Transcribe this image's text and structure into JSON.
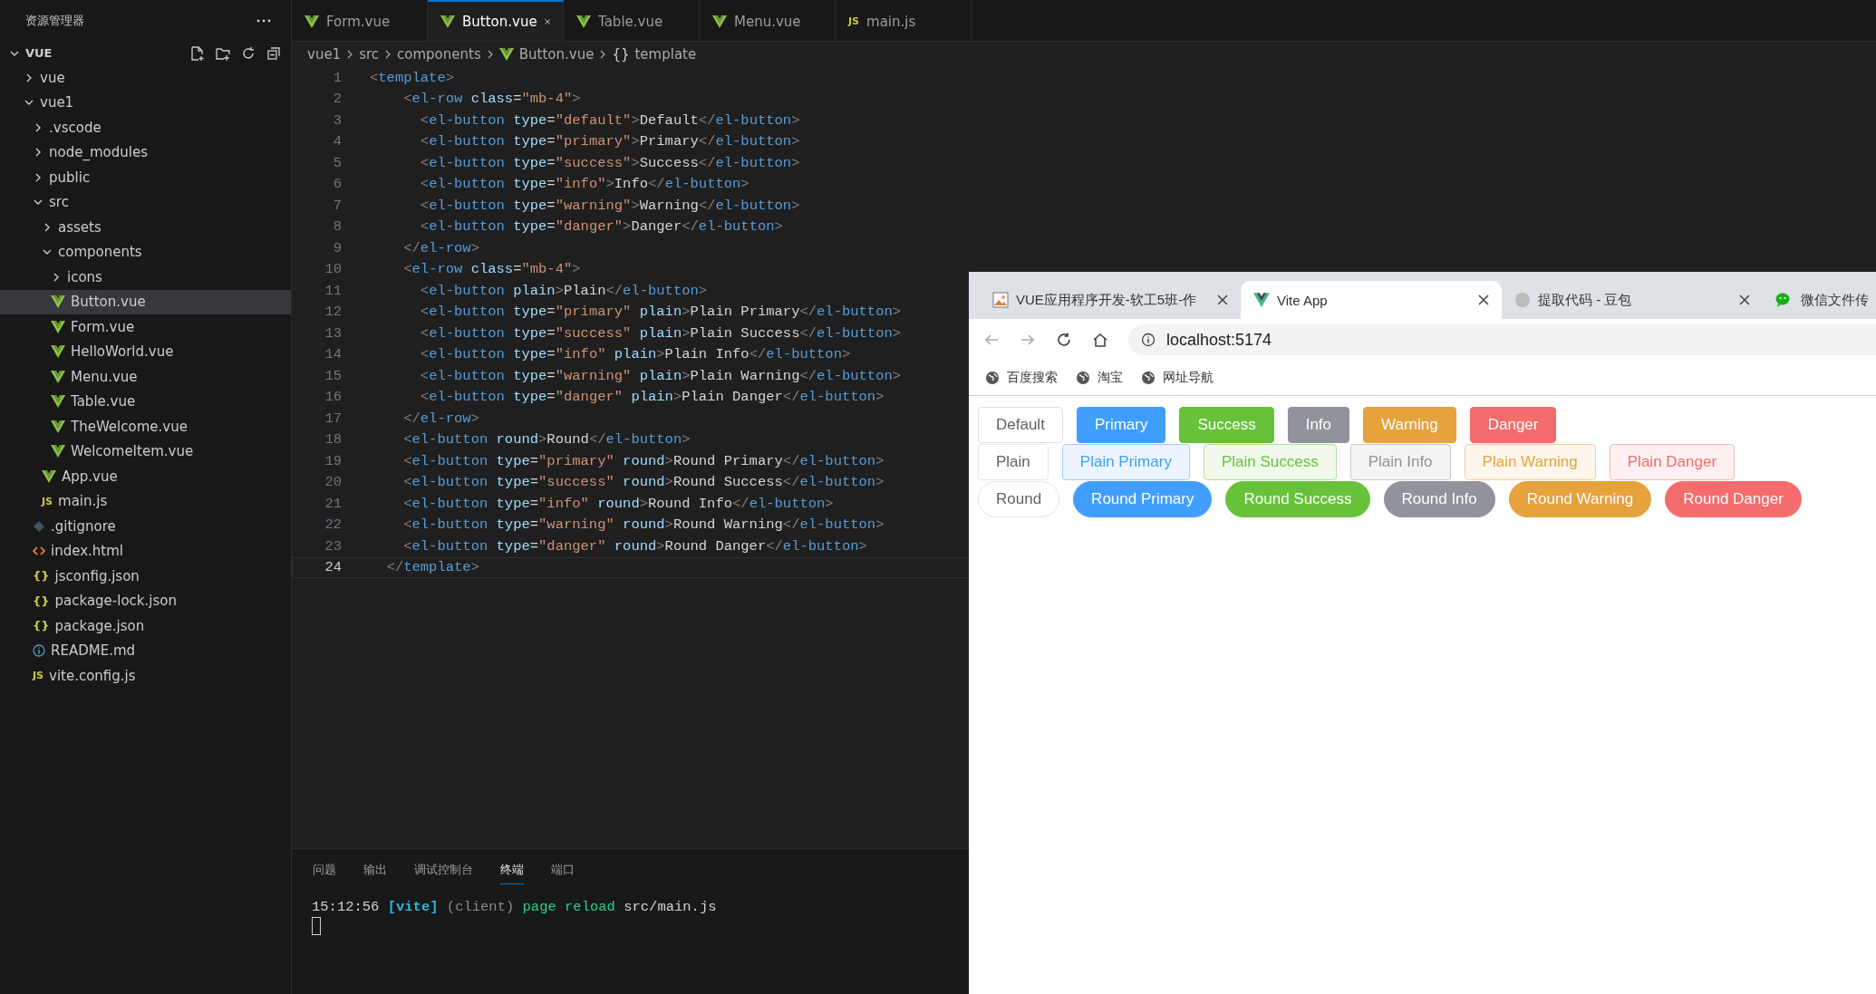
{
  "explorer": {
    "title": "资源管理器",
    "root": {
      "label": "VUE",
      "expanded": true,
      "children": [
        {
          "label": "vue",
          "kind": "folder",
          "expanded": false,
          "selected": false
        },
        {
          "label": "vue1",
          "kind": "folder",
          "expanded": true,
          "selected": false,
          "children": [
            {
              "label": ".vscode",
              "kind": "folder",
              "expanded": false,
              "selected": false
            },
            {
              "label": "node_modules",
              "kind": "folder",
              "expanded": false,
              "selected": false
            },
            {
              "label": "public",
              "kind": "folder",
              "expanded": false,
              "selected": false
            },
            {
              "label": "src",
              "kind": "folder",
              "expanded": true,
              "selected": false,
              "children": [
                {
                  "label": "assets",
                  "kind": "folder",
                  "expanded": false,
                  "selected": false
                },
                {
                  "label": "components",
                  "kind": "folder",
                  "expanded": true,
                  "selected": false,
                  "children": [
                    {
                      "label": "icons",
                      "kind": "folder",
                      "expanded": false,
                      "selected": false
                    },
                    {
                      "label": "Button.vue",
                      "kind": "vue",
                      "selected": true
                    },
                    {
                      "label": "Form.vue",
                      "kind": "vue",
                      "selected": false
                    },
                    {
                      "label": "HelloWorld.vue",
                      "kind": "vue",
                      "selected": false
                    },
                    {
                      "label": "Menu.vue",
                      "kind": "vue",
                      "selected": false
                    },
                    {
                      "label": "Table.vue",
                      "kind": "vue",
                      "selected": false
                    },
                    {
                      "label": "TheWelcome.vue",
                      "kind": "vue",
                      "selected": false
                    },
                    {
                      "label": "WelcomeItem.vue",
                      "kind": "vue",
                      "selected": false
                    }
                  ]
                },
                {
                  "label": "App.vue",
                  "kind": "vue",
                  "selected": false
                },
                {
                  "label": "main.js",
                  "kind": "js",
                  "icon_text": "JS",
                  "selected": false
                }
              ]
            },
            {
              "label": ".gitignore",
              "kind": "git",
              "selected": false
            },
            {
              "label": "index.html",
              "kind": "html",
              "selected": false
            },
            {
              "label": "jsconfig.json",
              "kind": "json",
              "icon_text": "{}",
              "selected": false
            },
            {
              "label": "package-lock.json",
              "kind": "json",
              "icon_text": "{}",
              "selected": false
            },
            {
              "label": "package.json",
              "kind": "json",
              "icon_text": "{}",
              "selected": false
            },
            {
              "label": "README.md",
              "kind": "info",
              "selected": false
            },
            {
              "label": "vite.config.js",
              "kind": "js",
              "icon_text": "JS",
              "selected": false
            }
          ]
        }
      ]
    }
  },
  "editor_tabs": [
    {
      "label": "Form.vue",
      "kind": "vue",
      "selected": false
    },
    {
      "label": "Button.vue",
      "kind": "vue",
      "selected": true
    },
    {
      "label": "Table.vue",
      "kind": "vue",
      "selected": false
    },
    {
      "label": "Menu.vue",
      "kind": "vue",
      "selected": false
    },
    {
      "label": "main.js",
      "kind": "js",
      "icon_text": "JS",
      "selected": false
    }
  ],
  "breadcrumbs": [
    {
      "label": "vue1",
      "kind": "folder"
    },
    {
      "label": "src",
      "kind": "folder"
    },
    {
      "label": "components",
      "kind": "folder"
    },
    {
      "label": "Button.vue",
      "kind": "vue"
    },
    {
      "label": "template",
      "kind": "symbol",
      "icon_text": "{}"
    }
  ],
  "code_lines": [
    {
      "number": "1",
      "current": false,
      "tokens": [
        {
          "kind": "punct",
          "text": "<"
        },
        {
          "kind": "tag",
          "text": "template"
        },
        {
          "kind": "punct",
          "text": ">"
        }
      ]
    },
    {
      "number": "2",
      "current": false,
      "tokens": [
        {
          "kind": "punct",
          "text": "    <"
        },
        {
          "kind": "tag",
          "text": "el-row"
        },
        {
          "kind": "attr",
          "text": " class"
        },
        {
          "kind": "text",
          "text": "="
        },
        {
          "kind": "string",
          "text": "\"mb-4\""
        },
        {
          "kind": "punct",
          "text": ">"
        }
      ]
    },
    {
      "number": "3",
      "current": false,
      "tokens": [
        {
          "kind": "punct",
          "text": "      <"
        },
        {
          "kind": "tag",
          "text": "el-button"
        },
        {
          "kind": "attr",
          "text": " type"
        },
        {
          "kind": "text",
          "text": "="
        },
        {
          "kind": "string",
          "text": "\"default\""
        },
        {
          "kind": "punct",
          "text": ">"
        },
        {
          "kind": "text",
          "text": "Default"
        },
        {
          "kind": "punct",
          "text": "</"
        },
        {
          "kind": "tag",
          "text": "el-button"
        },
        {
          "kind": "punct",
          "text": ">"
        }
      ]
    },
    {
      "number": "4",
      "current": false,
      "tokens": [
        {
          "kind": "punct",
          "text": "      <"
        },
        {
          "kind": "tag",
          "text": "el-button"
        },
        {
          "kind": "attr",
          "text": " type"
        },
        {
          "kind": "text",
          "text": "="
        },
        {
          "kind": "string",
          "text": "\"primary\""
        },
        {
          "kind": "punct",
          "text": ">"
        },
        {
          "kind": "text",
          "text": "Primary"
        },
        {
          "kind": "punct",
          "text": "</"
        },
        {
          "kind": "tag",
          "text": "el-button"
        },
        {
          "kind": "punct",
          "text": ">"
        }
      ]
    },
    {
      "number": "5",
      "current": false,
      "tokens": [
        {
          "kind": "punct",
          "text": "      <"
        },
        {
          "kind": "tag",
          "text": "el-button"
        },
        {
          "kind": "attr",
          "text": " type"
        },
        {
          "kind": "text",
          "text": "="
        },
        {
          "kind": "string",
          "text": "\"success\""
        },
        {
          "kind": "punct",
          "text": ">"
        },
        {
          "kind": "text",
          "text": "Success"
        },
        {
          "kind": "punct",
          "text": "</"
        },
        {
          "kind": "tag",
          "text": "el-button"
        },
        {
          "kind": "punct",
          "text": ">"
        }
      ]
    },
    {
      "number": "6",
      "current": false,
      "tokens": [
        {
          "kind": "punct",
          "text": "      <"
        },
        {
          "kind": "tag",
          "text": "el-button"
        },
        {
          "kind": "attr",
          "text": " type"
        },
        {
          "kind": "text",
          "text": "="
        },
        {
          "kind": "string",
          "text": "\"info\""
        },
        {
          "kind": "punct",
          "text": ">"
        },
        {
          "kind": "text",
          "text": "Info"
        },
        {
          "kind": "punct",
          "text": "</"
        },
        {
          "kind": "tag",
          "text": "el-button"
        },
        {
          "kind": "punct",
          "text": ">"
        }
      ]
    },
    {
      "number": "7",
      "current": false,
      "tokens": [
        {
          "kind": "punct",
          "text": "      <"
        },
        {
          "kind": "tag",
          "text": "el-button"
        },
        {
          "kind": "attr",
          "text": " type"
        },
        {
          "kind": "text",
          "text": "="
        },
        {
          "kind": "string",
          "text": "\"warning\""
        },
        {
          "kind": "punct",
          "text": ">"
        },
        {
          "kind": "text",
          "text": "Warning"
        },
        {
          "kind": "punct",
          "text": "</"
        },
        {
          "kind": "tag",
          "text": "el-button"
        },
        {
          "kind": "punct",
          "text": ">"
        }
      ]
    },
    {
      "number": "8",
      "current": false,
      "tokens": [
        {
          "kind": "punct",
          "text": "      <"
        },
        {
          "kind": "tag",
          "text": "el-button"
        },
        {
          "kind": "attr",
          "text": " type"
        },
        {
          "kind": "text",
          "text": "="
        },
        {
          "kind": "string",
          "text": "\"danger\""
        },
        {
          "kind": "punct",
          "text": ">"
        },
        {
          "kind": "text",
          "text": "Danger"
        },
        {
          "kind": "punct",
          "text": "</"
        },
        {
          "kind": "tag",
          "text": "el-button"
        },
        {
          "kind": "punct",
          "text": ">"
        }
      ]
    },
    {
      "number": "9",
      "current": false,
      "tokens": [
        {
          "kind": "punct",
          "text": "    </"
        },
        {
          "kind": "tag",
          "text": "el-row"
        },
        {
          "kind": "punct",
          "text": ">"
        }
      ]
    },
    {
      "number": "10",
      "current": false,
      "tokens": [
        {
          "kind": "punct",
          "text": "    <"
        },
        {
          "kind": "tag",
          "text": "el-row"
        },
        {
          "kind": "attr",
          "text": " class"
        },
        {
          "kind": "text",
          "text": "="
        },
        {
          "kind": "string",
          "text": "\"mb-4\""
        },
        {
          "kind": "punct",
          "text": ">"
        }
      ]
    },
    {
      "number": "11",
      "current": false,
      "tokens": [
        {
          "kind": "punct",
          "text": "      <"
        },
        {
          "kind": "tag",
          "text": "el-button"
        },
        {
          "kind": "attr",
          "text": " plain"
        },
        {
          "kind": "punct",
          "text": ">"
        },
        {
          "kind": "text",
          "text": "Plain"
        },
        {
          "kind": "punct",
          "text": "</"
        },
        {
          "kind": "tag",
          "text": "el-button"
        },
        {
          "kind": "punct",
          "text": ">"
        }
      ]
    },
    {
      "number": "12",
      "current": false,
      "tokens": [
        {
          "kind": "punct",
          "text": "      <"
        },
        {
          "kind": "tag",
          "text": "el-button"
        },
        {
          "kind": "attr",
          "text": " type"
        },
        {
          "kind": "text",
          "text": "="
        },
        {
          "kind": "string",
          "text": "\"primary\""
        },
        {
          "kind": "attr",
          "text": " plain"
        },
        {
          "kind": "punct",
          "text": ">"
        },
        {
          "kind": "text",
          "text": "Plain Primary"
        },
        {
          "kind": "punct",
          "text": "</"
        },
        {
          "kind": "tag",
          "text": "el-button"
        },
        {
          "kind": "punct",
          "text": ">"
        }
      ]
    },
    {
      "number": "13",
      "current": false,
      "tokens": [
        {
          "kind": "punct",
          "text": "      <"
        },
        {
          "kind": "tag",
          "text": "el-button"
        },
        {
          "kind": "attr",
          "text": " type"
        },
        {
          "kind": "text",
          "text": "="
        },
        {
          "kind": "string",
          "text": "\"success\""
        },
        {
          "kind": "attr",
          "text": " plain"
        },
        {
          "kind": "punct",
          "text": ">"
        },
        {
          "kind": "text",
          "text": "Plain Success"
        },
        {
          "kind": "punct",
          "text": "</"
        },
        {
          "kind": "tag",
          "text": "el-button"
        },
        {
          "kind": "punct",
          "text": ">"
        }
      ]
    },
    {
      "number": "14",
      "current": false,
      "tokens": [
        {
          "kind": "punct",
          "text": "      <"
        },
        {
          "kind": "tag",
          "text": "el-button"
        },
        {
          "kind": "attr",
          "text": " type"
        },
        {
          "kind": "text",
          "text": "="
        },
        {
          "kind": "string",
          "text": "\"info\""
        },
        {
          "kind": "attr",
          "text": " plain"
        },
        {
          "kind": "punct",
          "text": ">"
        },
        {
          "kind": "text",
          "text": "Plain Info"
        },
        {
          "kind": "punct",
          "text": "</"
        },
        {
          "kind": "tag",
          "text": "el-button"
        },
        {
          "kind": "punct",
          "text": ">"
        }
      ]
    },
    {
      "number": "15",
      "current": false,
      "tokens": [
        {
          "kind": "punct",
          "text": "      <"
        },
        {
          "kind": "tag",
          "text": "el-button"
        },
        {
          "kind": "attr",
          "text": " type"
        },
        {
          "kind": "text",
          "text": "="
        },
        {
          "kind": "string",
          "text": "\"warning\""
        },
        {
          "kind": "attr",
          "text": " plain"
        },
        {
          "kind": "punct",
          "text": ">"
        },
        {
          "kind": "text",
          "text": "Plain Warning"
        },
        {
          "kind": "punct",
          "text": "</"
        },
        {
          "kind": "tag",
          "text": "el-button"
        },
        {
          "kind": "punct",
          "text": ">"
        }
      ]
    },
    {
      "number": "16",
      "current": false,
      "tokens": [
        {
          "kind": "punct",
          "text": "      <"
        },
        {
          "kind": "tag",
          "text": "el-button"
        },
        {
          "kind": "attr",
          "text": " type"
        },
        {
          "kind": "text",
          "text": "="
        },
        {
          "kind": "string",
          "text": "\"danger\""
        },
        {
          "kind": "attr",
          "text": " plain"
        },
        {
          "kind": "punct",
          "text": ">"
        },
        {
          "kind": "text",
          "text": "Plain Danger"
        },
        {
          "kind": "punct",
          "text": "</"
        },
        {
          "kind": "tag",
          "text": "el-button"
        },
        {
          "kind": "punct",
          "text": ">"
        }
      ]
    },
    {
      "number": "17",
      "current": false,
      "tokens": [
        {
          "kind": "punct",
          "text": "    </"
        },
        {
          "kind": "tag",
          "text": "el-row"
        },
        {
          "kind": "punct",
          "text": ">"
        }
      ]
    },
    {
      "number": "18",
      "current": false,
      "tokens": [
        {
          "kind": "punct",
          "text": "    <"
        },
        {
          "kind": "tag",
          "text": "el-button"
        },
        {
          "kind": "attr",
          "text": " round"
        },
        {
          "kind": "punct",
          "text": ">"
        },
        {
          "kind": "text",
          "text": "Round"
        },
        {
          "kind": "punct",
          "text": "</"
        },
        {
          "kind": "tag",
          "text": "el-button"
        },
        {
          "kind": "punct",
          "text": ">"
        }
      ]
    },
    {
      "number": "19",
      "current": false,
      "tokens": [
        {
          "kind": "punct",
          "text": "    <"
        },
        {
          "kind": "tag",
          "text": "el-button"
        },
        {
          "kind": "attr",
          "text": " type"
        },
        {
          "kind": "text",
          "text": "="
        },
        {
          "kind": "string",
          "text": "\"primary\""
        },
        {
          "kind": "attr",
          "text": " round"
        },
        {
          "kind": "punct",
          "text": ">"
        },
        {
          "kind": "text",
          "text": "Round Primary"
        },
        {
          "kind": "punct",
          "text": "</"
        },
        {
          "kind": "tag",
          "text": "el-button"
        },
        {
          "kind": "punct",
          "text": ">"
        }
      ]
    },
    {
      "number": "20",
      "current": false,
      "tokens": [
        {
          "kind": "punct",
          "text": "    <"
        },
        {
          "kind": "tag",
          "text": "el-button"
        },
        {
          "kind": "attr",
          "text": " type"
        },
        {
          "kind": "text",
          "text": "="
        },
        {
          "kind": "string",
          "text": "\"success\""
        },
        {
          "kind": "attr",
          "text": " round"
        },
        {
          "kind": "punct",
          "text": ">"
        },
        {
          "kind": "text",
          "text": "Round Success"
        },
        {
          "kind": "punct",
          "text": "</"
        },
        {
          "kind": "tag",
          "text": "el-button"
        },
        {
          "kind": "punct",
          "text": ">"
        }
      ]
    },
    {
      "number": "21",
      "current": false,
      "tokens": [
        {
          "kind": "punct",
          "text": "    <"
        },
        {
          "kind": "tag",
          "text": "el-button"
        },
        {
          "kind": "attr",
          "text": " type"
        },
        {
          "kind": "text",
          "text": "="
        },
        {
          "kind": "string",
          "text": "\"info\""
        },
        {
          "kind": "attr",
          "text": " round"
        },
        {
          "kind": "punct",
          "text": ">"
        },
        {
          "kind": "text",
          "text": "Round Info"
        },
        {
          "kind": "punct",
          "text": "</"
        },
        {
          "kind": "tag",
          "text": "el-button"
        },
        {
          "kind": "punct",
          "text": ">"
        }
      ]
    },
    {
      "number": "22",
      "current": false,
      "tokens": [
        {
          "kind": "punct",
          "text": "    <"
        },
        {
          "kind": "tag",
          "text": "el-button"
        },
        {
          "kind": "attr",
          "text": " type"
        },
        {
          "kind": "text",
          "text": "="
        },
        {
          "kind": "string",
          "text": "\"warning\""
        },
        {
          "kind": "attr",
          "text": " round"
        },
        {
          "kind": "punct",
          "text": ">"
        },
        {
          "kind": "text",
          "text": "Round Warning"
        },
        {
          "kind": "punct",
          "text": "</"
        },
        {
          "kind": "tag",
          "text": "el-button"
        },
        {
          "kind": "punct",
          "text": ">"
        }
      ]
    },
    {
      "number": "23",
      "current": false,
      "tokens": [
        {
          "kind": "punct",
          "text": "    <"
        },
        {
          "kind": "tag",
          "text": "el-button"
        },
        {
          "kind": "attr",
          "text": " type"
        },
        {
          "kind": "text",
          "text": "="
        },
        {
          "kind": "string",
          "text": "\"danger\""
        },
        {
          "kind": "attr",
          "text": " round"
        },
        {
          "kind": "punct",
          "text": ">"
        },
        {
          "kind": "text",
          "text": "Round Danger"
        },
        {
          "kind": "punct",
          "text": "</"
        },
        {
          "kind": "tag",
          "text": "el-button"
        },
        {
          "kind": "punct",
          "text": ">"
        }
      ]
    },
    {
      "number": "24",
      "current": true,
      "tokens": [
        {
          "kind": "punct",
          "text": "  </"
        },
        {
          "kind": "tag",
          "text": "template"
        },
        {
          "kind": "punct",
          "text": ">"
        }
      ]
    }
  ],
  "panel": {
    "tabs": [
      {
        "label": "问题",
        "selected": false
      },
      {
        "label": "输出",
        "selected": false
      },
      {
        "label": "调试控制台",
        "selected": false
      },
      {
        "label": "终端",
        "selected": true
      },
      {
        "label": "端口",
        "selected": false
      }
    ],
    "terminal_tokens": [
      {
        "kind": "text",
        "text": "15:12:56 "
      },
      {
        "kind": "bold",
        "text": "[vite]"
      },
      {
        "kind": "dim",
        "text": " (client) "
      },
      {
        "kind": "green",
        "text": "page reload "
      },
      {
        "kind": "text",
        "text": "src/main.js"
      }
    ]
  },
  "browser": {
    "tabs": [
      {
        "title": "VUE应用程序开发-软工5班-作",
        "kind": "image",
        "selected": false
      },
      {
        "title": "Vite App",
        "kind": "vue",
        "selected": true
      },
      {
        "title": "提取代码 - 豆包",
        "kind": "avatar",
        "selected": false
      },
      {
        "title": "微信文件传",
        "kind": "chat",
        "selected": false
      }
    ],
    "url": "localhost:5174",
    "bookmarks": [
      "百度搜索",
      "淘宝",
      "网址导航"
    ],
    "button_rows": [
      {
        "kind": "solid",
        "buttons": [
          {
            "label": "Default",
            "kind": "default"
          },
          {
            "label": "Primary",
            "kind": "primary"
          },
          {
            "label": "Success",
            "kind": "success"
          },
          {
            "label": "Info",
            "kind": "info"
          },
          {
            "label": "Warning",
            "kind": "warning"
          },
          {
            "label": "Danger",
            "kind": "danger"
          }
        ]
      },
      {
        "kind": "plain",
        "buttons": [
          {
            "label": "Plain",
            "kind": "default"
          },
          {
            "label": "Plain Primary",
            "kind": "primary"
          },
          {
            "label": "Plain Success",
            "kind": "success"
          },
          {
            "label": "Plain Info",
            "kind": "info"
          },
          {
            "label": "Plain Warning",
            "kind": "warning"
          },
          {
            "label": "Plain Danger",
            "kind": "danger"
          }
        ]
      },
      {
        "kind": "round",
        "buttons": [
          {
            "label": "Round",
            "kind": "default"
          },
          {
            "label": "Round Primary",
            "kind": "primary"
          },
          {
            "label": "Round Success",
            "kind": "success"
          },
          {
            "label": "Round Info",
            "kind": "info"
          },
          {
            "label": "Round Warning",
            "kind": "warning"
          },
          {
            "label": "Round Danger",
            "kind": "danger"
          }
        ]
      }
    ]
  }
}
